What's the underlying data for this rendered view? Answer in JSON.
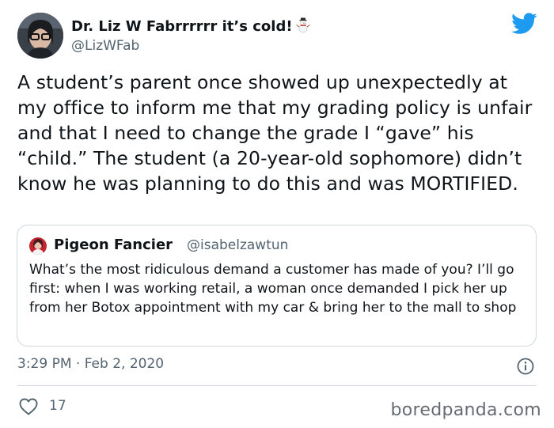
{
  "author": {
    "display_name": "Dr. Liz W Fabrrrrrr it’s cold!",
    "emoji_icon": "snowman-icon",
    "handle": "@LizWFab",
    "avatar_icon": "profile-photo"
  },
  "platform_icon": "twitter-bird-icon",
  "accent_color": "#1d9bf0",
  "tweet_text": "A student’s parent once showed up unexpectedly at my office to inform me that my grading policy is unfair and that I need to change the grade I “gave” his “child.” The student (a 20-year-old sophomore) didn’t know he was planning to do this and was MORTIFIED.",
  "quoted_tweet": {
    "display_name": "Pigeon Fancier",
    "handle": "@isabelzawtun",
    "text": "What’s the most ridiculous demand a customer has made of you? I’ll go first: when I was working retail, a woman once demanded I pick her up from her Botox appointment with my car & bring her to the mall to shop"
  },
  "timestamp": "3:29 PM · Feb 2, 2020",
  "like_count": "17",
  "watermark": "boredpanda.com"
}
